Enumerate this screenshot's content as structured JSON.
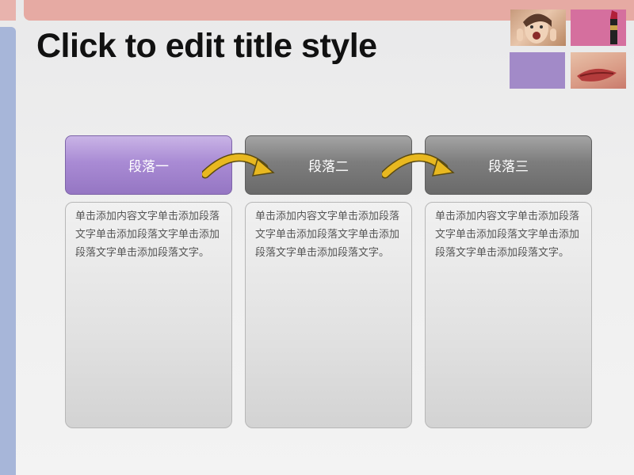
{
  "slide": {
    "title": "Click to edit title style"
  },
  "steps": [
    {
      "label": "段落一",
      "body": "单击添加内容文字单击添加段落文字单击添加段落文字单击添加段落文字单击添加段落文字。"
    },
    {
      "label": "段落二",
      "body": "单击添加内容文字单击添加段落文字单击添加段落文字单击添加段落文字单击添加段落文字。"
    },
    {
      "label": "段落三",
      "body": "单击添加内容文字单击添加段落文字单击添加段落文字单击添加段落文字单击添加段落文字。"
    }
  ],
  "colors": {
    "band_top": "#e6aaa3",
    "band_left": "#a7b6d9",
    "step_active": "#a98bd4",
    "step_inactive": "#7d7d7d",
    "arrow": "#e8b820"
  },
  "icons": {
    "connector": "curved-arrow-right-icon"
  }
}
